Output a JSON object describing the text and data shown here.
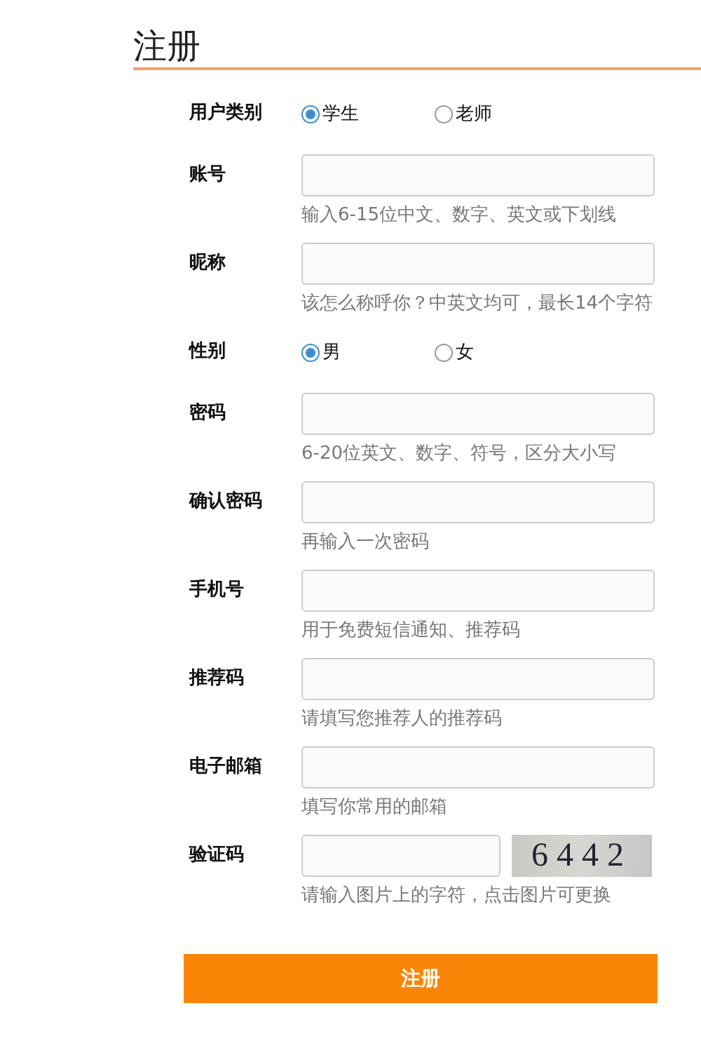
{
  "title": "注册",
  "fields": [
    {
      "kind": "radio",
      "label": "用户类别",
      "options": [
        {
          "label": "学生",
          "selected": true
        },
        {
          "label": "老师",
          "selected": false
        }
      ]
    },
    {
      "kind": "text",
      "label": "账号",
      "hint": "输入6-15位中文、数字、英文或下划线"
    },
    {
      "kind": "text",
      "label": "昵称",
      "hint": "该怎么称呼你？中英文均可，最长14个字符"
    },
    {
      "kind": "radio",
      "label": "性别",
      "options": [
        {
          "label": "男",
          "selected": true
        },
        {
          "label": "女",
          "selected": false
        }
      ]
    },
    {
      "kind": "text",
      "label": "密码",
      "hint": "6-20位英文、数字、符号，区分大小写"
    },
    {
      "kind": "text",
      "label": "确认密码",
      "hint": "再输入一次密码"
    },
    {
      "kind": "text",
      "label": "手机号",
      "hint": "用于免费短信通知、推荐码"
    },
    {
      "kind": "text",
      "label": "推荐码",
      "hint": "请填写您推荐人的推荐码"
    },
    {
      "kind": "text",
      "label": "电子邮箱",
      "hint": "填写你常用的邮箱"
    },
    {
      "kind": "captcha",
      "label": "验证码",
      "code": "6442",
      "hint": "请输入图片上的字符，点击图片可更换"
    }
  ],
  "submit": "注册"
}
